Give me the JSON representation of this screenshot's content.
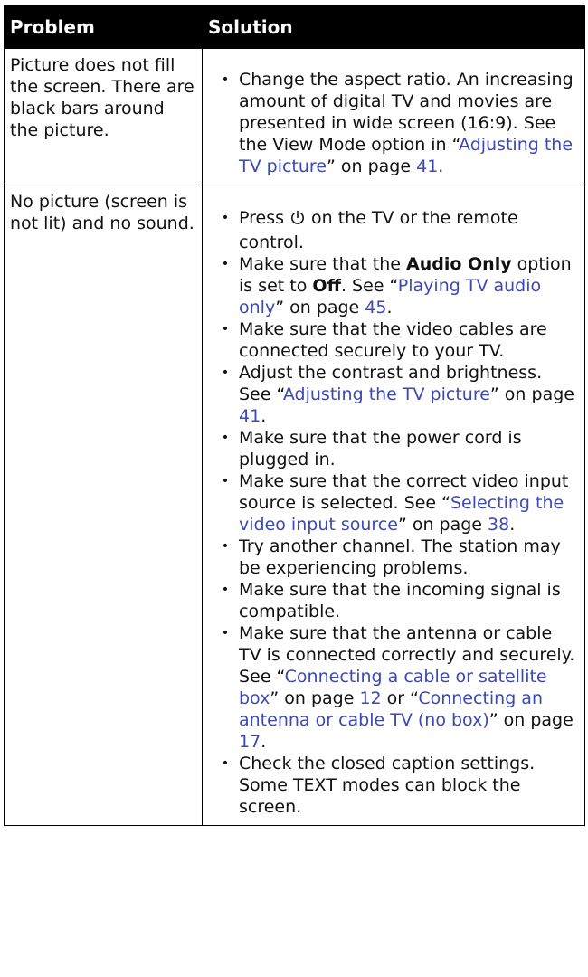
{
  "header": {
    "problem": "Problem",
    "solution": "Solution"
  },
  "rows": [
    {
      "problem": "Picture does not fill the screen. There are black bars around the picture.",
      "solutions": [
        {
          "pre": "Change the aspect ratio. An increasing amount of digital TV and movies are presented in wide screen (16:9). See the View Mode option in “",
          "link": "Adjusting the TV picture",
          "mid": "” on page ",
          "page": "41",
          "post": "."
        }
      ]
    },
    {
      "problem": "No picture (screen is not lit) and no sound.",
      "solutions": [
        {
          "pre": "Press",
          "icon": "power-icon",
          "post": "on the TV or the remote control."
        },
        {
          "pre": "Make sure that the ",
          "bold1": "Audio Only",
          "mid1": " option is set to ",
          "bold2": "Off",
          "mid2": ". See “",
          "link": "Playing TV audio only",
          "mid3": "” on page ",
          "page": "45",
          "post": "."
        },
        {
          "text": "Make sure that the video cables are connected securely to your TV."
        },
        {
          "pre": "Adjust the contrast and brightness. See “",
          "link": "Adjusting the TV picture",
          "mid": "” on page ",
          "page": "41",
          "post": "."
        },
        {
          "text": "Make sure that the power cord is plugged in."
        },
        {
          "pre": "Make sure that the correct video input source is selected. See “",
          "link": "Selecting the video input source",
          "mid": "” on page ",
          "page": "38",
          "post": "."
        },
        {
          "text": "Try another channel. The station may be experiencing problems."
        },
        {
          "text": "Make sure that the incoming signal is compatible."
        },
        {
          "pre": "Make sure that the antenna or cable TV is connected correctly and securely. See “",
          "link": "Connecting a cable or satellite box",
          "mid": "” on page ",
          "page": "12",
          "mid2": " or “",
          "link2": "Connecting an antenna or cable TV (no box)",
          "mid3": "” on page ",
          "page2": "17",
          "post": "."
        },
        {
          "text": "Check the closed caption settings. Some TEXT modes can block the screen."
        }
      ]
    }
  ]
}
